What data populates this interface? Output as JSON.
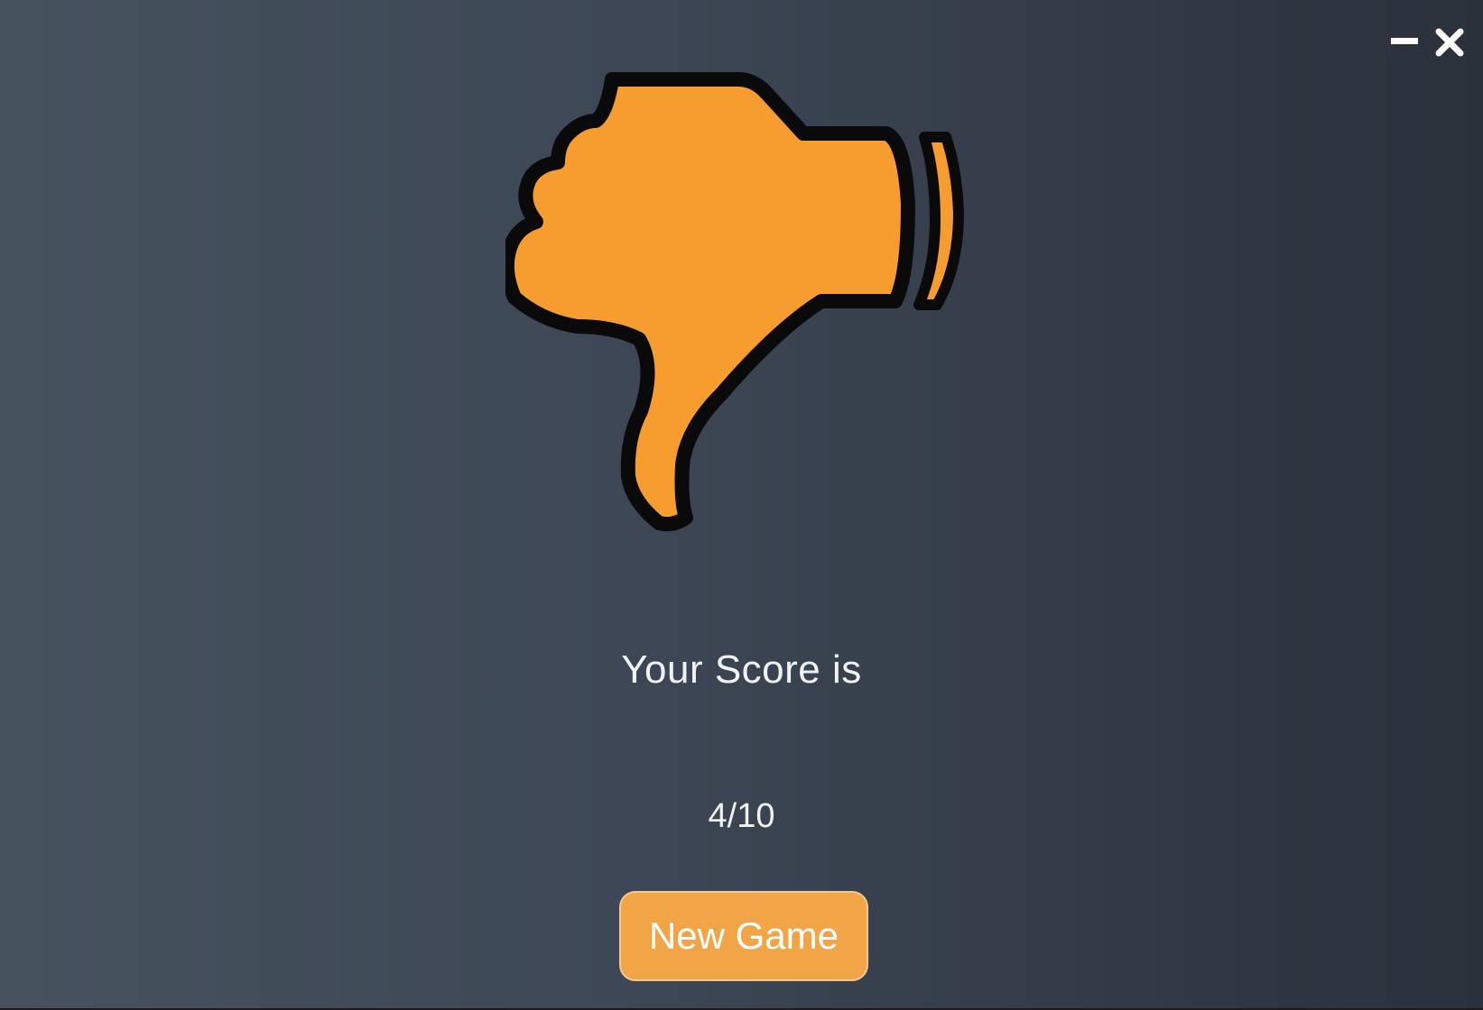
{
  "window": {
    "minimize_icon": "minimize-icon",
    "close_icon": "close-icon"
  },
  "result": {
    "icon": "thumbs-down-icon",
    "icon_color": "#f79d30",
    "score_label": "Your Score is",
    "score_value": "4/10"
  },
  "actions": {
    "new_game_label": "New Game",
    "button_color": "#f2a547"
  }
}
